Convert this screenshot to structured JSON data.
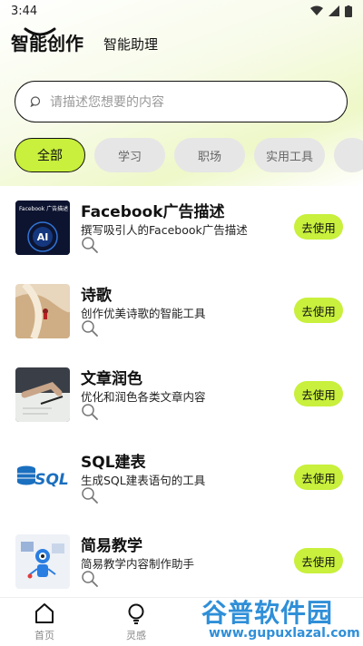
{
  "status_bar": {
    "time": "3:44"
  },
  "header": {
    "tabs": [
      {
        "label": "智能创作"
      },
      {
        "label": "智能助理"
      }
    ]
  },
  "search": {
    "placeholder": "请描述您想要的内容"
  },
  "categories": [
    {
      "label": "全部",
      "active": true
    },
    {
      "label": "学习"
    },
    {
      "label": "职场"
    },
    {
      "label": "实用工具"
    }
  ],
  "tools": [
    {
      "title": "Facebook广告描述",
      "desc": "撰写吸引人的Facebook广告描述",
      "button": "去使用",
      "thumb_text": "Facebook 广告描述",
      "thumb_ai": "AI"
    },
    {
      "title": "诗歌",
      "desc": "创作优美诗歌的智能工具",
      "button": "去使用"
    },
    {
      "title": "文章润色",
      "desc": "优化和润色各类文章内容",
      "button": "去使用"
    },
    {
      "title": "SQL建表",
      "desc": "生成SQL建表语句的工具",
      "button": "去使用",
      "thumb_text": "SQL"
    },
    {
      "title": "简易教学",
      "desc": "简易教学内容制作助手",
      "button": "去使用"
    }
  ],
  "bottom_nav": [
    {
      "label": "首页",
      "icon": "home-icon"
    },
    {
      "label": "灵感",
      "icon": "bulb-icon"
    }
  ],
  "watermark": {
    "main": "谷普软件园",
    "url": "www.gupuxlazal.com"
  },
  "colors": {
    "accent": "#c8f03c",
    "chip_bg": "#e6e6e6",
    "watermark": "#2f8fd8"
  }
}
